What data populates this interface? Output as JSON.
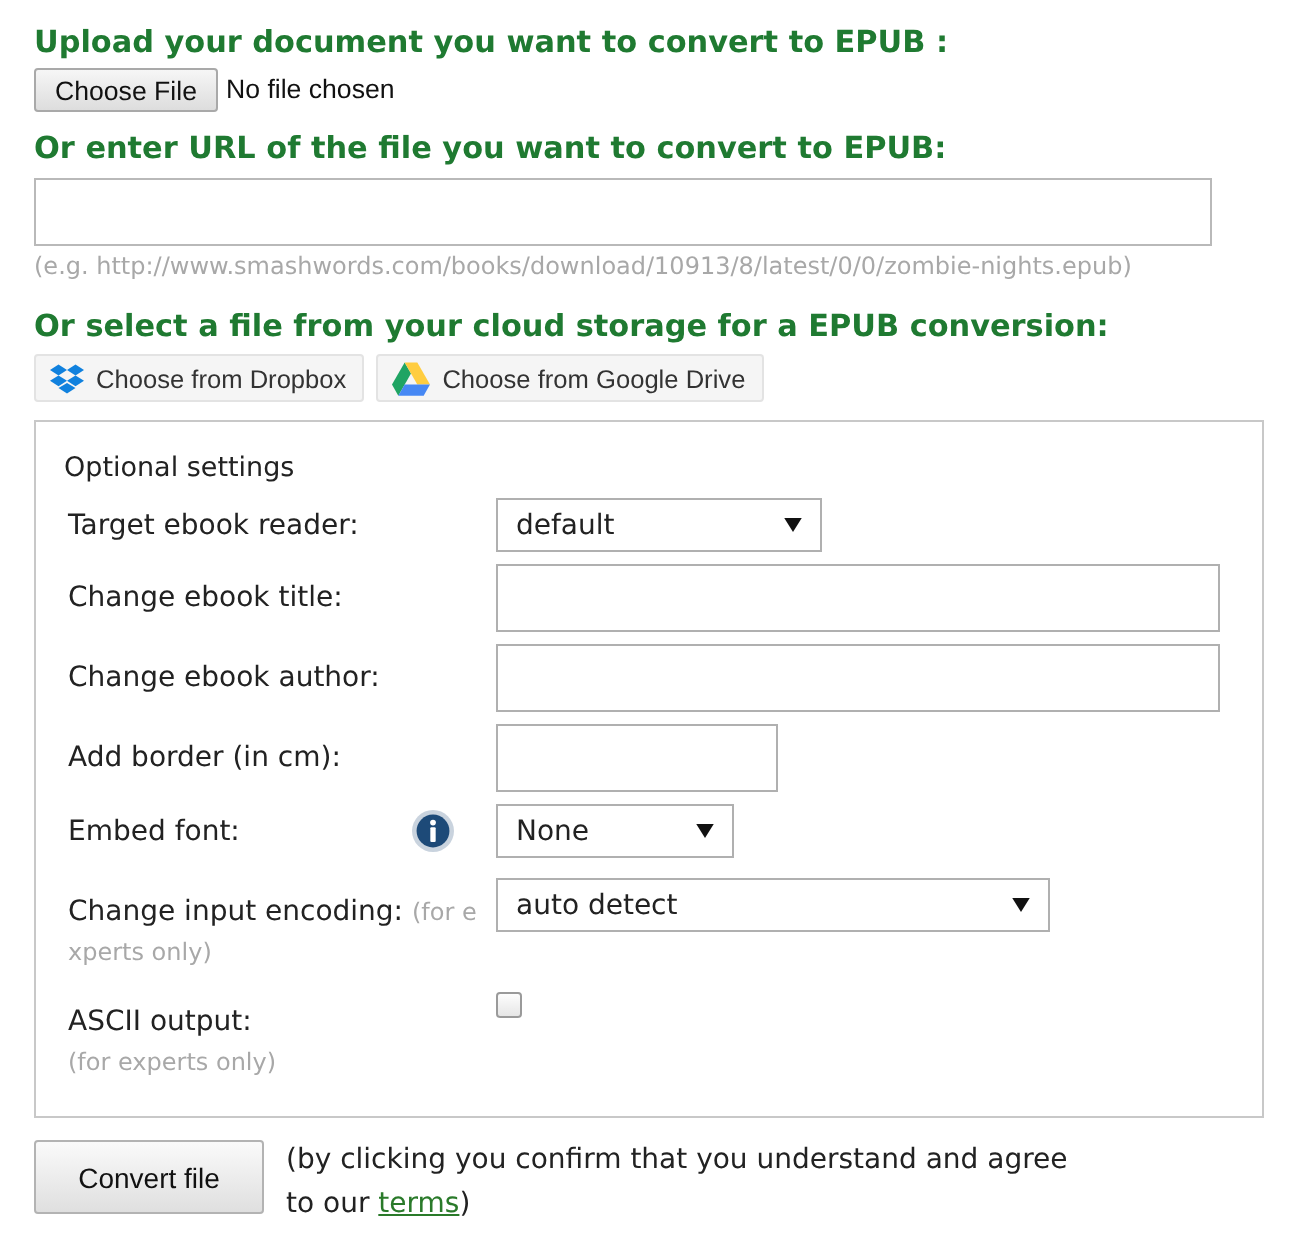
{
  "upload": {
    "heading": "Upload your document you want to convert to EPUB :",
    "file_button": "Choose File",
    "file_status": "No file chosen"
  },
  "url": {
    "heading": "Or enter URL of the file you want to convert to EPUB:",
    "hint": "(e.g. http://www.smashwords.com/books/download/10913/8/latest/0/0/zombie-nights.epub)"
  },
  "cloud": {
    "heading": "Or select a file from your cloud storage for a EPUB conversion:",
    "buttons": [
      {
        "kind": "dropbox",
        "label": "Choose from Dropbox"
      },
      {
        "kind": "drive",
        "label": "Choose from Google Drive"
      }
    ]
  },
  "settings": {
    "title": "Optional settings",
    "rows": [
      {
        "kind": "select",
        "label": "Target ebook reader:",
        "value": "default"
      },
      {
        "kind": "text",
        "label": "Change ebook title:"
      },
      {
        "kind": "text",
        "label": "Change ebook author:"
      },
      {
        "kind": "number",
        "label": "Add border (in cm):"
      },
      {
        "kind": "select",
        "label": "Embed font:",
        "value": "None",
        "info": true
      },
      {
        "kind": "select",
        "label": "Change input encoding:",
        "note": "(for experts only)",
        "value": "auto detect"
      },
      {
        "kind": "checkbox",
        "label": "ASCII output:",
        "note": "(for experts only)",
        "checked": false
      }
    ]
  },
  "convert": {
    "button": "Convert file",
    "notice": "(by clicking you confirm that you understand and agree to our",
    "link": "terms",
    "notice_end": ")"
  }
}
